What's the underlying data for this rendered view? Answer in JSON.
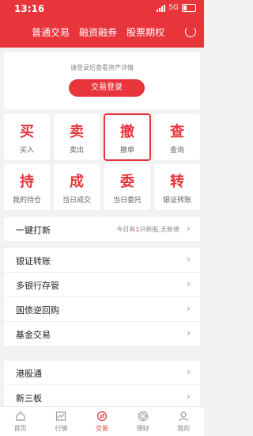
{
  "status": {
    "time": "13:16",
    "network": "5G"
  },
  "header": {
    "tabs": [
      "普通交易",
      "融资融券",
      "股票期权"
    ]
  },
  "login": {
    "tip": "请登录后查看资产详情",
    "button": "交易登录"
  },
  "grid": [
    {
      "big": "买",
      "small": "买入"
    },
    {
      "big": "卖",
      "small": "卖出"
    },
    {
      "big": "撤",
      "small": "撤单"
    },
    {
      "big": "查",
      "small": "查询"
    },
    {
      "big": "持",
      "small": "我的持仓"
    },
    {
      "big": "成",
      "small": "当日成交"
    },
    {
      "big": "委",
      "small": "当日委托"
    },
    {
      "big": "转",
      "small": "银证转账"
    }
  ],
  "ipo": {
    "label": "一键打新",
    "note_pre": "今日有",
    "note_num": "1",
    "note_post": "只新股,无新债"
  },
  "list1": [
    "银证转账",
    "多银行存管",
    "国债逆回购",
    "基金交易"
  ],
  "list2": [
    "港股通",
    "新三板"
  ],
  "tabbar": [
    "首页",
    "行情",
    "交易",
    "理财",
    "我的"
  ]
}
